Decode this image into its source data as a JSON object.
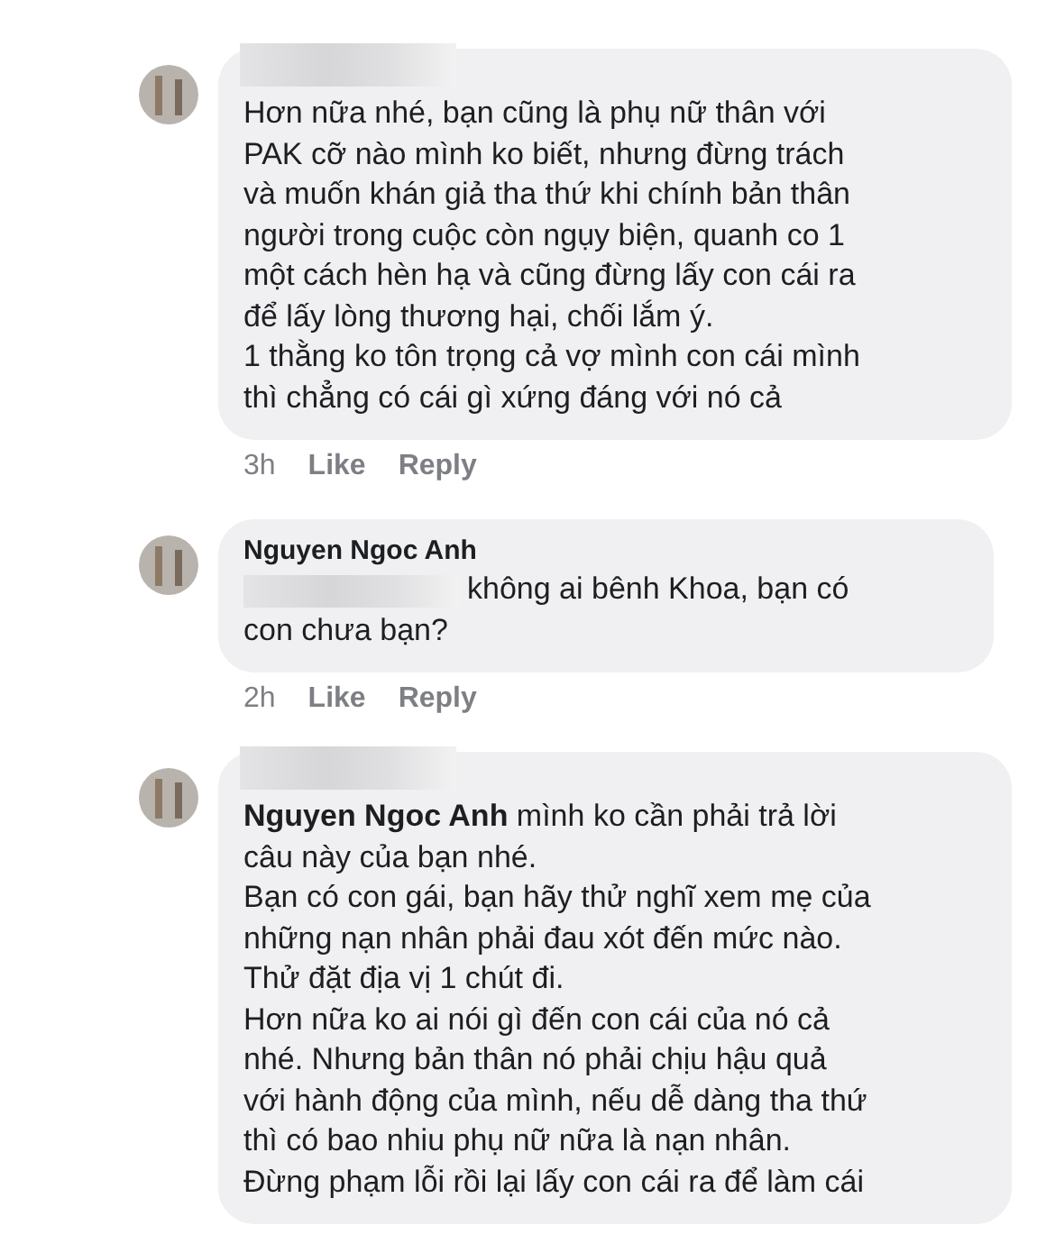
{
  "comments": [
    {
      "name_redacted": true,
      "text": "Hơn nữa nhé, bạn cũng là phụ nữ thân với\nPAK cỡ nào mình ko biết, nhưng đừng trách\nvà muốn khán giả tha thứ khi chính bản thân\nngười trong cuộc còn ngụy biện, quanh co 1\nmột cách hèn hạ và cũng đừng lấy con cái ra\nđể lấy lòng thương hại, chối lắm ý.\n1 thằng ko tôn trọng cả vợ mình con cái mình\nthì chẳng có cái gì xứng đáng với nó cả",
      "time": "3h",
      "actions": [
        "Like",
        "Reply"
      ]
    },
    {
      "name_redacted": false,
      "author": "Nguyen Ngoc Anh",
      "text_prefix_redacted": true,
      "text": "không ai bênh Khoa, bạn có\ncon chưa bạn?",
      "time": "2h",
      "actions": [
        "Like",
        "Reply"
      ]
    },
    {
      "name_redacted": true,
      "text": "**Nguyen Ngoc Anh** mình ko cần phải trả lời\ncâu này của bạn nhé.\nBạn có con gái, bạn hãy thử nghĩ xem mẹ của\nnhững nạn nhân phải đau xót đến mức nào.\nThử đặt địa vị 1 chút đi.\nHơn nữa ko ai nói gì đến con cái của nó cả\nnhé. Nhưng bản thân nó phải chịu hậu quả\nvới hành động của mình, nếu dễ dàng tha thứ\nthì có bao nhiu phụ nữ nữa là nạn nhân.\nĐừng phạm lỗi rồi lại lấy con cái ra để làm cái"
    }
  ]
}
